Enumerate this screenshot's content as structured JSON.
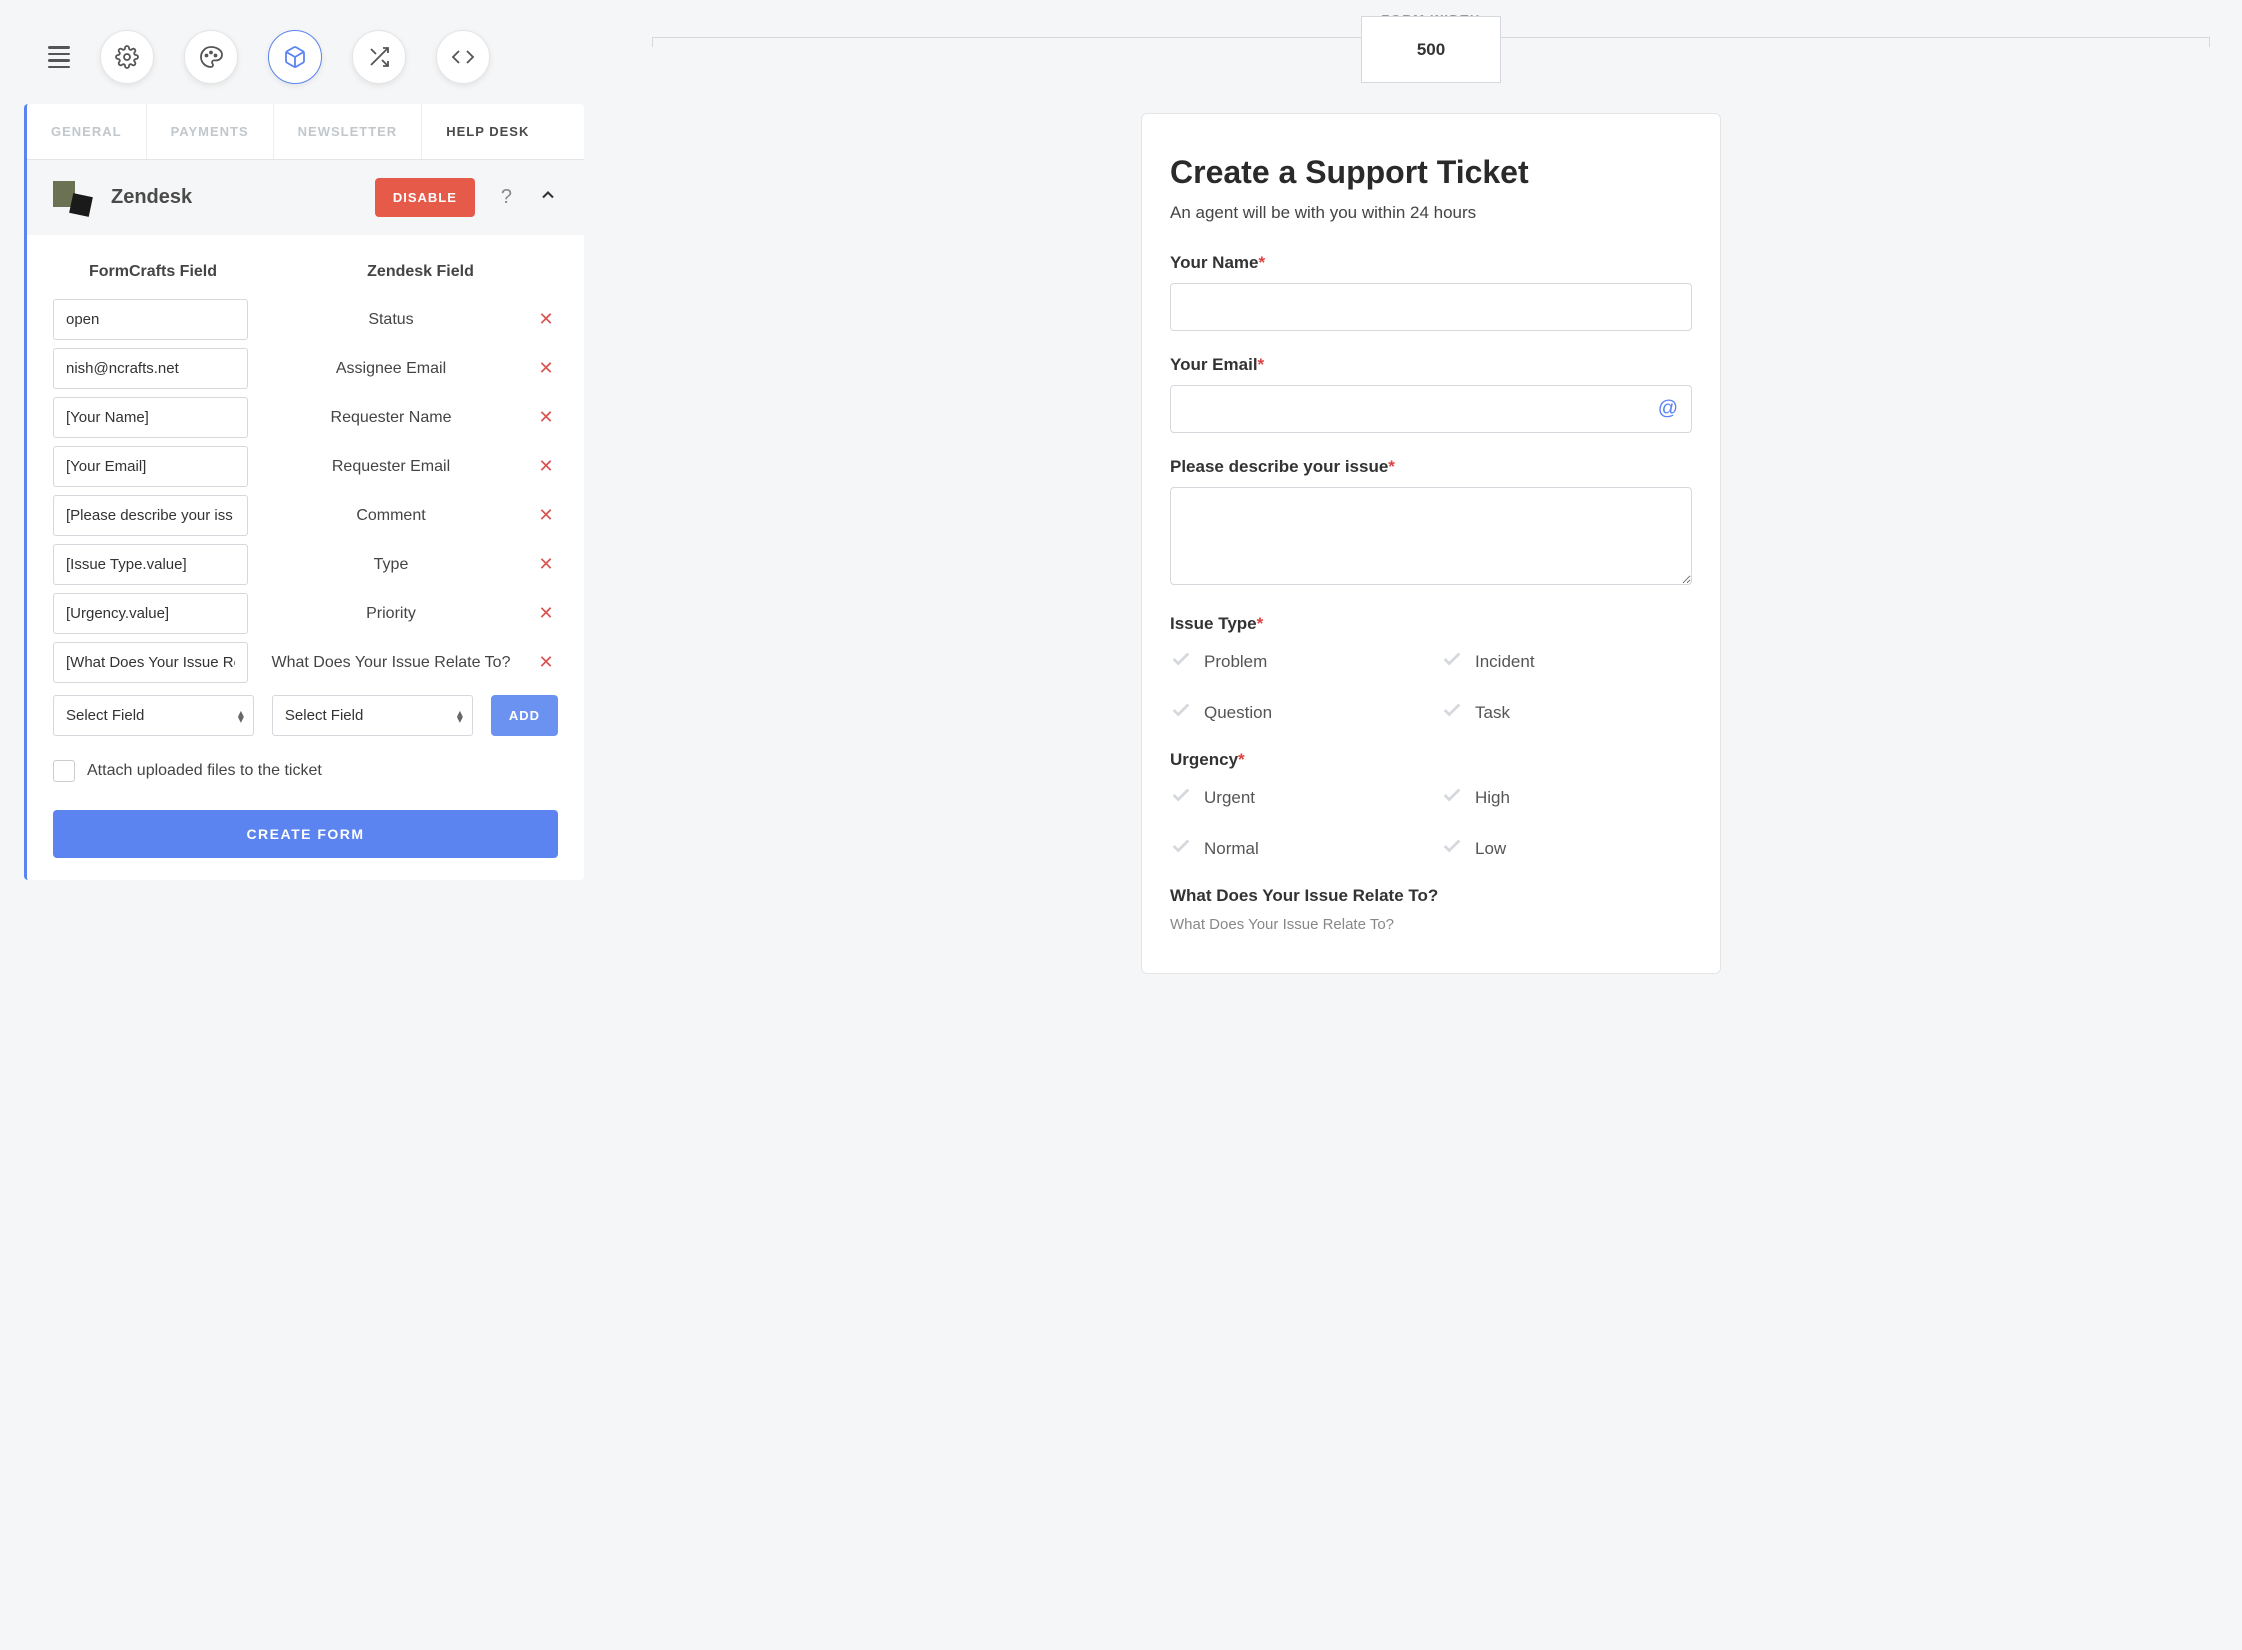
{
  "toolbar": {
    "icons": [
      "menu",
      "gear",
      "palette",
      "cube",
      "shuffle",
      "code"
    ]
  },
  "panel": {
    "tabs": [
      {
        "label": "GENERAL",
        "active": false
      },
      {
        "label": "PAYMENTS",
        "active": false
      },
      {
        "label": "NEWSLETTER",
        "active": false
      },
      {
        "label": "HELP DESK",
        "active": true
      }
    ],
    "integration": {
      "name": "Zendesk",
      "disable_label": "DISABLE"
    },
    "mapping": {
      "header_left": "FormCrafts Field",
      "header_right": "Zendesk Field",
      "rows": [
        {
          "fc": "open",
          "zd": "Status"
        },
        {
          "fc": "nish@ncrafts.net",
          "zd": "Assignee Email"
        },
        {
          "fc": "[Your Name]",
          "zd": "Requester Name"
        },
        {
          "fc": "[Your Email]",
          "zd": "Requester Email"
        },
        {
          "fc": "[Please describe your iss",
          "zd": "Comment"
        },
        {
          "fc": "[Issue Type.value]",
          "zd": "Type"
        },
        {
          "fc": "[Urgency.value]",
          "zd": "Priority"
        },
        {
          "fc": "[What Does Your Issue Re",
          "zd": "What Does Your Issue Relate To?"
        }
      ],
      "select_placeholder_left": "Select Field",
      "select_placeholder_right": "Select Field",
      "add_label": "ADD"
    },
    "attach_label": "Attach uploaded files to the ticket",
    "create_form_label": "CREATE FORM"
  },
  "preview": {
    "form_width_label": "FORM WIDTH",
    "form_width_value": "500",
    "title": "Create a Support Ticket",
    "subtitle": "An agent will be with you within 24 hours",
    "fields": {
      "name": {
        "label": "Your Name",
        "required": true
      },
      "email": {
        "label": "Your Email",
        "required": true
      },
      "describe": {
        "label": "Please describe your issue",
        "required": true
      },
      "issue_type": {
        "label": "Issue Type",
        "required": true,
        "options": [
          "Problem",
          "Incident",
          "Question",
          "Task"
        ]
      },
      "urgency": {
        "label": "Urgency",
        "required": true,
        "options": [
          "Urgent",
          "High",
          "Normal",
          "Low"
        ]
      },
      "relate": {
        "label": "What Does Your Issue Relate To?",
        "sublabel": "What Does Your Issue Relate To?"
      }
    }
  }
}
